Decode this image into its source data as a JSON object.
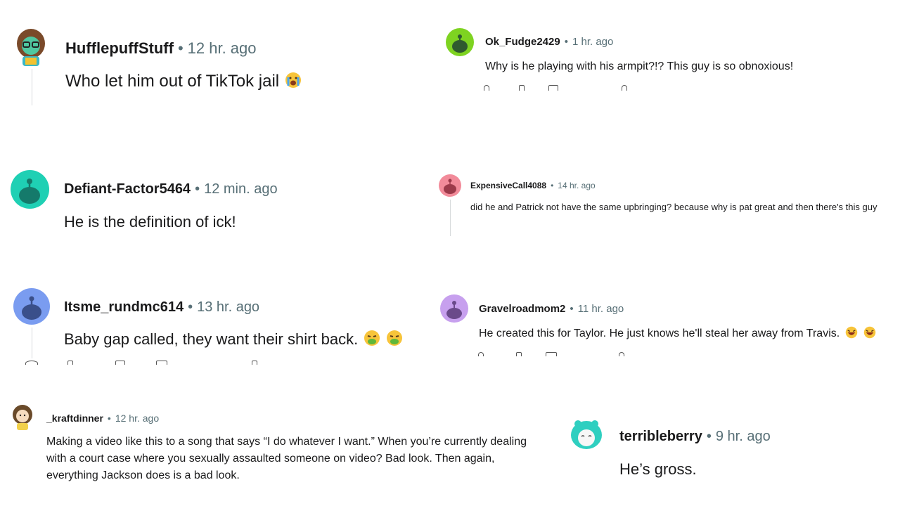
{
  "comments": [
    {
      "id": "c1",
      "user": "HufflepuffStuff",
      "time": "12 hr. ago",
      "text": "Who let him out of TikTok jail"
    },
    {
      "id": "c2",
      "user": "Ok_Fudge2429",
      "time": "1 hr. ago",
      "text": "Why is he playing with his armpit?!? This guy is so obnoxious!"
    },
    {
      "id": "c3",
      "user": "Defiant-Factor5464",
      "time": "12 min. ago",
      "text": "He is the definition of ick!"
    },
    {
      "id": "c4",
      "user": "ExpensiveCall4088",
      "time": "14 hr. ago",
      "text": "did he and Patrick not have the same upbringing? because why is pat great and then there's this guy"
    },
    {
      "id": "c5",
      "user": "Itsme_rundmc614",
      "time": "13 hr. ago",
      "text": "Baby gap called, they want their shirt back."
    },
    {
      "id": "c6",
      "user": "Gravelroadmom2",
      "time": "11 hr. ago",
      "text": "He created this for Taylor. He just knows he'll steal her away from Travis."
    },
    {
      "id": "c7",
      "user": "_kraftdinner",
      "time": "12 hr. ago",
      "text": "Making a video like this to a song that says “I do whatever I want.” When you’re currently dealing with a court case where you sexually assaulted someone on video? Bad look. Then again, everything Jackson does is a bad look."
    },
    {
      "id": "c8",
      "user": "terribleberry",
      "time": "9 hr. ago",
      "text": "He’s gross."
    }
  ],
  "separator": "•",
  "icons": {
    "c1": "crying-face-emoji",
    "c5": "vomiting-face-emoji",
    "c6": "laughing-face-emoji"
  },
  "colors": {
    "avatar_green": "#7ed321",
    "avatar_teal": "#1fd0b4",
    "avatar_pink": "#f28b9a",
    "avatar_blue": "#7a9cf0",
    "avatar_purple": "#c7a0ee",
    "meta": "#576f76"
  }
}
